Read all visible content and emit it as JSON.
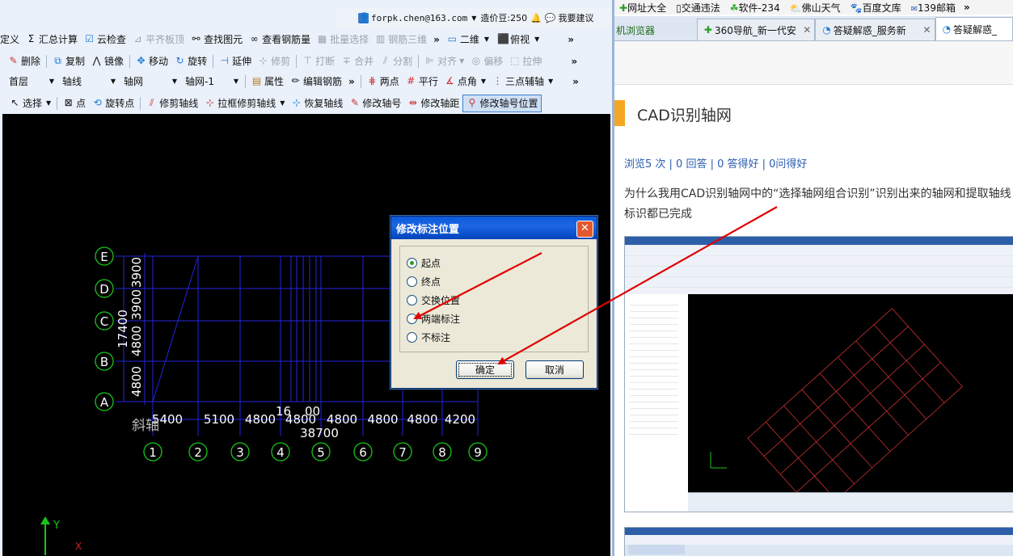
{
  "top_bar": {
    "account": "forpk.chen@163.com",
    "price": "造价豆:250",
    "suggest": "我要建议"
  },
  "toolbar1": {
    "items": [
      "定义",
      "汇总计算",
      "云检查",
      "平齐板顶",
      "查找图元",
      "查看钢筋量",
      "批量选择",
      "钢筋三维"
    ],
    "view_combo": "二维",
    "view_mode": "俯视"
  },
  "toolbar2": {
    "items": [
      "删除",
      "复制",
      "镜像",
      "移动",
      "旋转",
      "延伸",
      "修剪",
      "打断",
      "合并",
      "分割",
      "对齐",
      "偏移",
      "拉伸"
    ]
  },
  "toolbar3": {
    "floor": "首层",
    "type": "轴线",
    "sub": "轴网",
    "axis": "轴网-1",
    "props": "属性",
    "edit_rebar": "编辑钢筋",
    "two_point": "两点",
    "parallel": "平行",
    "point_angle": "点角",
    "three_point": "三点辅轴"
  },
  "toolbar4": {
    "items": [
      "选择",
      "点",
      "旋转点",
      "修剪轴线",
      "拉框修剪轴线",
      "恢复轴线",
      "修改轴号",
      "修改轴距",
      "修改轴号位置"
    ]
  },
  "cad": {
    "row_labels": [
      "E",
      "D",
      "C",
      "B",
      "A"
    ],
    "col_labels": [
      "1",
      "2",
      "3",
      "4",
      "5",
      "6",
      "7",
      "8",
      "9"
    ],
    "left_dims": [
      "4800",
      "4800",
      "3900",
      "3900"
    ],
    "left_total": "17400",
    "bottom_dims": [
      "5400",
      "5100",
      "4800",
      "4800",
      "4800",
      "4800",
      "4800",
      "4200"
    ],
    "bottom_total": "38700",
    "overlap_label": "16",
    "overlap_label2": "00",
    "slant_label": "斜轴",
    "ucs_y": "Y",
    "ucs_x": "X"
  },
  "dialog": {
    "title": "修改标注位置",
    "options": [
      "起点",
      "终点",
      "交换位置",
      "两端标注",
      "不标注"
    ],
    "selected": 0,
    "ok": "确定",
    "cancel": "取消",
    "close": "✕"
  },
  "browser": {
    "bookmarks": [
      "网址大全",
      "交通违法",
      "软件-234",
      "佛山天气",
      "百度文库",
      "139邮箱"
    ],
    "tabs": [
      "机浏览器",
      "360导航_新一代安",
      "答疑解惑_服务新",
      "答疑解惑_"
    ],
    "question_title": "CAD识别轴网",
    "stats": "浏览5 次 | 0 回答 | 0 答得好 | 0问得好",
    "question_body": "为什么我用CAD识别轴网中的“选择轴网组合识别”识别出来的轴网和提取轴线标识都已完成"
  },
  "colors": {
    "grid": "#2323e0",
    "cad_text": "#ffffff",
    "arrow": "#e00000",
    "dialog_title": "#0a5ad8",
    "link": "#2a5db0"
  }
}
